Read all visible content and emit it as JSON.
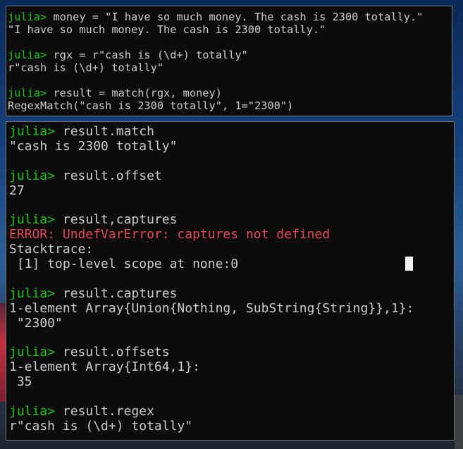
{
  "colors": {
    "terminal_bg": "#0c0c0c",
    "text": "#cccccc",
    "prompt": "#16c60c",
    "error": "#e74856",
    "cursor": "#f2f2f2"
  },
  "top_terminal": {
    "lines": [
      {
        "prompt": "julia>",
        "text": " money = \"I have so much money. The cash is 2300 totally.\""
      },
      {
        "prompt": "",
        "text": "\"I have so much money. The cash is 2300 totally.\""
      },
      {
        "prompt": "",
        "text": ""
      },
      {
        "prompt": "julia>",
        "text": " rgx = r\"cash is (\\d+) totally\""
      },
      {
        "prompt": "",
        "text": "r\"cash is (\\d+) totally\""
      },
      {
        "prompt": "",
        "text": ""
      },
      {
        "prompt": "julia>",
        "text": " result = match(rgx, money)"
      },
      {
        "prompt": "",
        "text": "RegexMatch(\"cash is 2300 totally\", 1=\"2300\")"
      }
    ]
  },
  "bottom_terminal": {
    "lines": [
      {
        "prompt": "julia>",
        "text": " result.match"
      },
      {
        "prompt": "",
        "text": "\"cash is 2300 totally\""
      },
      {
        "prompt": "",
        "text": ""
      },
      {
        "prompt": "julia>",
        "text": " result.offset"
      },
      {
        "prompt": "",
        "text": "27"
      },
      {
        "prompt": "",
        "text": ""
      },
      {
        "prompt": "julia>",
        "text": " result,captures"
      },
      {
        "prompt": "",
        "text": "ERROR: UndefVarError: captures not defined",
        "error": true
      },
      {
        "prompt": "",
        "text": "Stacktrace:"
      },
      {
        "prompt": "",
        "text": " [1] top-level scope at none:0"
      },
      {
        "prompt": "",
        "text": ""
      },
      {
        "prompt": "julia>",
        "text": " result.captures"
      },
      {
        "prompt": "",
        "text": "1-element Array{Union{Nothing, SubString{String}},1}:"
      },
      {
        "prompt": "",
        "text": " \"2300\""
      },
      {
        "prompt": "",
        "text": ""
      },
      {
        "prompt": "julia>",
        "text": " result.offsets"
      },
      {
        "prompt": "",
        "text": "1-element Array{Int64,1}:"
      },
      {
        "prompt": "",
        "text": " 35"
      },
      {
        "prompt": "",
        "text": ""
      },
      {
        "prompt": "julia>",
        "text": " result.regex"
      },
      {
        "prompt": "",
        "text": "r\"cash is (\\d+) totally\""
      }
    ]
  }
}
